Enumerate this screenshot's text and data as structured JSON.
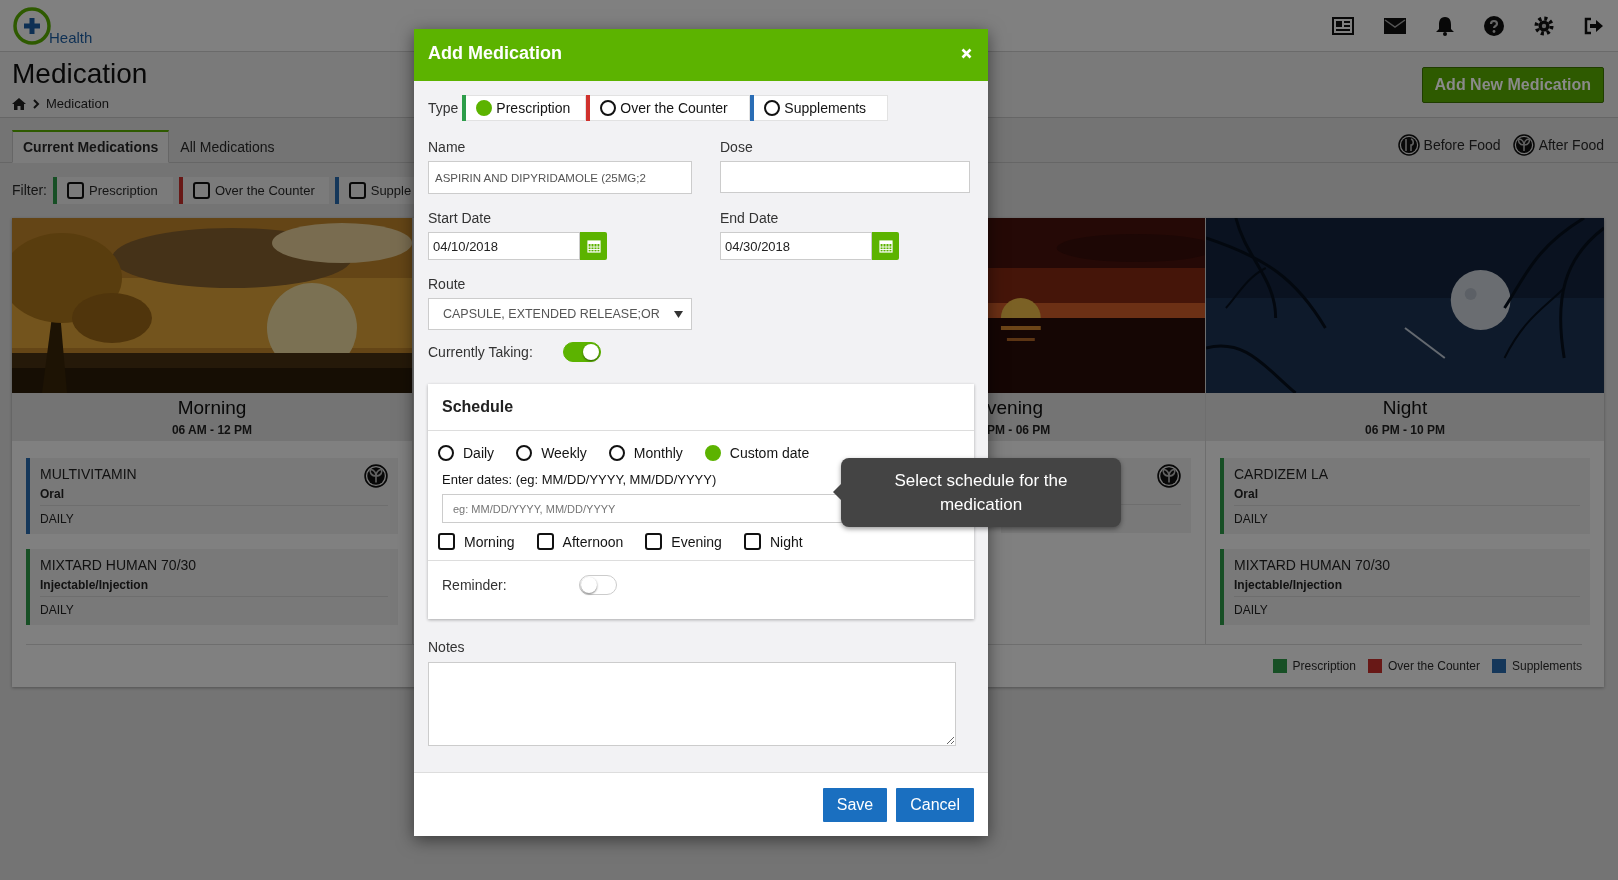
{
  "header": {
    "logo_text": "Health"
  },
  "page": {
    "title": "Medication",
    "breadcrumb": "Medication",
    "add_button": "Add New Medication"
  },
  "tabs": [
    {
      "label": "Current Medications",
      "selected": true
    },
    {
      "label": "All Medications",
      "selected": false
    }
  ],
  "food_legend": [
    {
      "kind": "before",
      "label": "Before Food"
    },
    {
      "kind": "after",
      "label": "After Food"
    }
  ],
  "filter": {
    "label": "Filter:",
    "options": [
      {
        "label": "Prescription",
        "color": "#174f25",
        "checked": false
      },
      {
        "label": "Over the Counter",
        "color": "#681816",
        "checked": false
      },
      {
        "label": "Supple",
        "color": "#15375a",
        "checked": false
      }
    ]
  },
  "columns": [
    {
      "kind": "full",
      "name": "Morning",
      "hours": "06 AM - 12 PM",
      "cards": [
        {
          "name": "MULTIVITAMIN",
          "route": "Oral",
          "frequency": "DAILY",
          "color": "#15375a",
          "after_food": true
        },
        {
          "name": "MIXTARD HUMAN 70/30",
          "route": "Injectable/Injection",
          "frequency": "DAILY",
          "color": "#174f25",
          "after_food": false
        }
      ]
    },
    {
      "kind": "partial",
      "name": "vening",
      "hours": "PM - 06 PM",
      "cards": [
        {
          "after_food": true
        }
      ]
    },
    {
      "kind": "full",
      "name": "Night",
      "hours": "06 PM - 10 PM",
      "cards": [
        {
          "name": "CARDIZEM LA",
          "route": "Oral",
          "frequency": "DAILY",
          "color": "#174f25",
          "after_food": false
        },
        {
          "name": "MIXTARD HUMAN 70/30",
          "route": "Injectable/Injection",
          "frequency": "DAILY",
          "color": "#174f25",
          "after_food": false
        }
      ]
    }
  ],
  "legend": [
    {
      "label": "Prescription",
      "color": "#174f25"
    },
    {
      "label": "Over the Counter",
      "color": "#681816"
    },
    {
      "label": "Supplements",
      "color": "#15375a"
    }
  ],
  "modal": {
    "title": "Add Medication",
    "type_label": "Type",
    "types": [
      {
        "label": "Prescription",
        "color": "#2e9e4a",
        "selected": true
      },
      {
        "label": "Over the Counter",
        "color": "#d0312d",
        "selected": false
      },
      {
        "label": "Supplements",
        "color": "#2a6db5",
        "selected": false
      }
    ],
    "name_label": "Name",
    "name_value": "ASPIRIN AND DIPYRIDAMOLE (25MG;2",
    "dose_label": "Dose",
    "start_label": "Start Date",
    "start_value": "04/10/2018",
    "end_label": "End Date",
    "end_value": "04/30/2018",
    "route_label": "Route",
    "route_value": "CAPSULE, EXTENDED RELEASE;OR",
    "currently_taking": {
      "label": "Currently Taking:",
      "on": true
    },
    "schedule": {
      "title": "Schedule",
      "options": [
        {
          "label": "Daily",
          "selected": false
        },
        {
          "label": "Weekly",
          "selected": false
        },
        {
          "label": "Monthly",
          "selected": false
        },
        {
          "label": "Custom date",
          "selected": true
        }
      ],
      "dates_label": "Enter dates: (eg: MM/DD/YYYY, MM/DD/YYYY)",
      "dates_placeholder": "eg: MM/DD/YYYY, MM/DD/YYYY",
      "times": [
        {
          "label": "Morning",
          "checked": false
        },
        {
          "label": "Afternoon",
          "checked": false
        },
        {
          "label": "Evening",
          "checked": false
        },
        {
          "label": "Night",
          "checked": false
        }
      ],
      "reminder": {
        "label": "Reminder:",
        "on": false
      }
    },
    "notes_label": "Notes",
    "buttons": [
      {
        "label": "Save"
      },
      {
        "label": "Cancel"
      }
    ]
  },
  "tooltip": "Select schedule for the medication"
}
